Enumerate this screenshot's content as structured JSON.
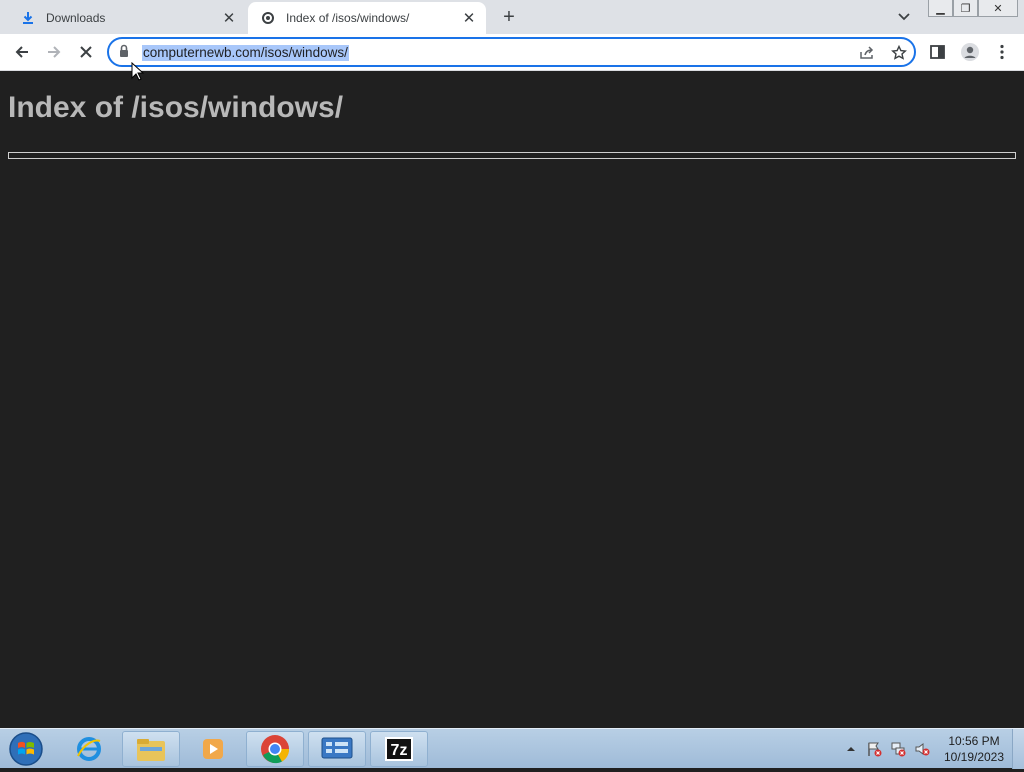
{
  "browser": {
    "tabs": [
      {
        "title": "Downloads",
        "icon": "download-icon",
        "active": false
      },
      {
        "title": "Index of /isos/windows/",
        "icon": "site-favicon-icon",
        "active": true
      }
    ],
    "omnibox": {
      "url": "computernewb.com/isos/windows/"
    }
  },
  "page": {
    "heading": "Index of /isos/windows/"
  },
  "taskbar": {
    "apps": [
      "internet-explorer-icon",
      "file-explorer-icon",
      "media-player-icon",
      "chrome-icon",
      "control-panel-icon",
      "7zip-icon"
    ],
    "sevenzip_label": "7z",
    "clock": {
      "time": "10:56 PM",
      "date": "10/19/2023"
    }
  },
  "colors": {
    "page_bg": "#202020",
    "accent": "#1a73e8",
    "selection": "#a8c7fa"
  }
}
